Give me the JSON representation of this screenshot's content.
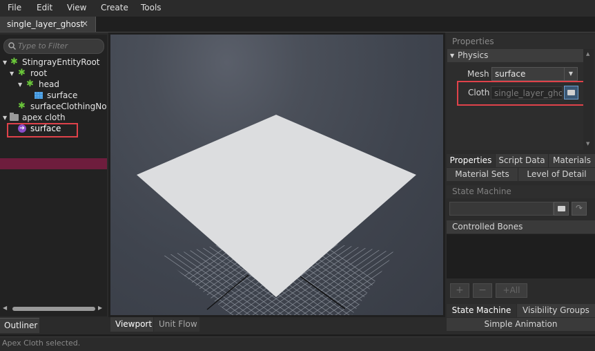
{
  "menu": [
    "File",
    "Edit",
    "View",
    "Create",
    "Tools"
  ],
  "document_tab": {
    "label": "single_layer_ghost",
    "close": "×"
  },
  "outliner": {
    "filter_placeholder": "Type to Filter",
    "tree": [
      {
        "label": "StingrayEntityRoot",
        "icon": "entity-gear-icon",
        "expanded": true
      },
      {
        "label": "root",
        "icon": "entity-gear-icon",
        "expanded": true
      },
      {
        "label": "head",
        "icon": "entity-gear-icon",
        "expanded": true
      },
      {
        "label": "surface",
        "icon": "mesh-grid-icon"
      },
      {
        "label": "surfaceClothingNode",
        "icon": "entity-gear-icon"
      },
      {
        "label": "apex cloth",
        "icon": "folder-icon",
        "expanded": true
      },
      {
        "label": "surface",
        "icon": "apex-cloth-icon",
        "selected": true
      }
    ],
    "tab_label": "Outliner"
  },
  "viewport": {
    "tabs": [
      "Viewport",
      "Unit Flow"
    ],
    "active_tab": "Viewport"
  },
  "properties": {
    "header": "Properties",
    "section": "Physics",
    "mesh_label": "Mesh",
    "mesh_value": "surface",
    "cloth_label": "Cloth",
    "cloth_value": "single_layer_ghost",
    "tabs_row1": [
      "Properties",
      "Script Data",
      "Materials"
    ],
    "tabs_row2": [
      "Material Sets",
      "Level of Detail"
    ],
    "active_tab": "Properties"
  },
  "state_machine": {
    "header": "State Machine",
    "controlled_bones": "Controlled Bones",
    "add_label": "+",
    "remove_label": "−",
    "add_all_label": "+All",
    "tabs_row1": [
      "State Machine",
      "Visibility Groups"
    ],
    "tabs_row2": [
      "Simple Animation"
    ],
    "active_tab": "State Machine"
  },
  "status": "Apex Cloth selected.",
  "colors": {
    "selection": "#6e1d3d",
    "highlight_box": "#e0424a",
    "entity_icon": "#6ac63a",
    "apex_icon": "#8a4cc8"
  }
}
